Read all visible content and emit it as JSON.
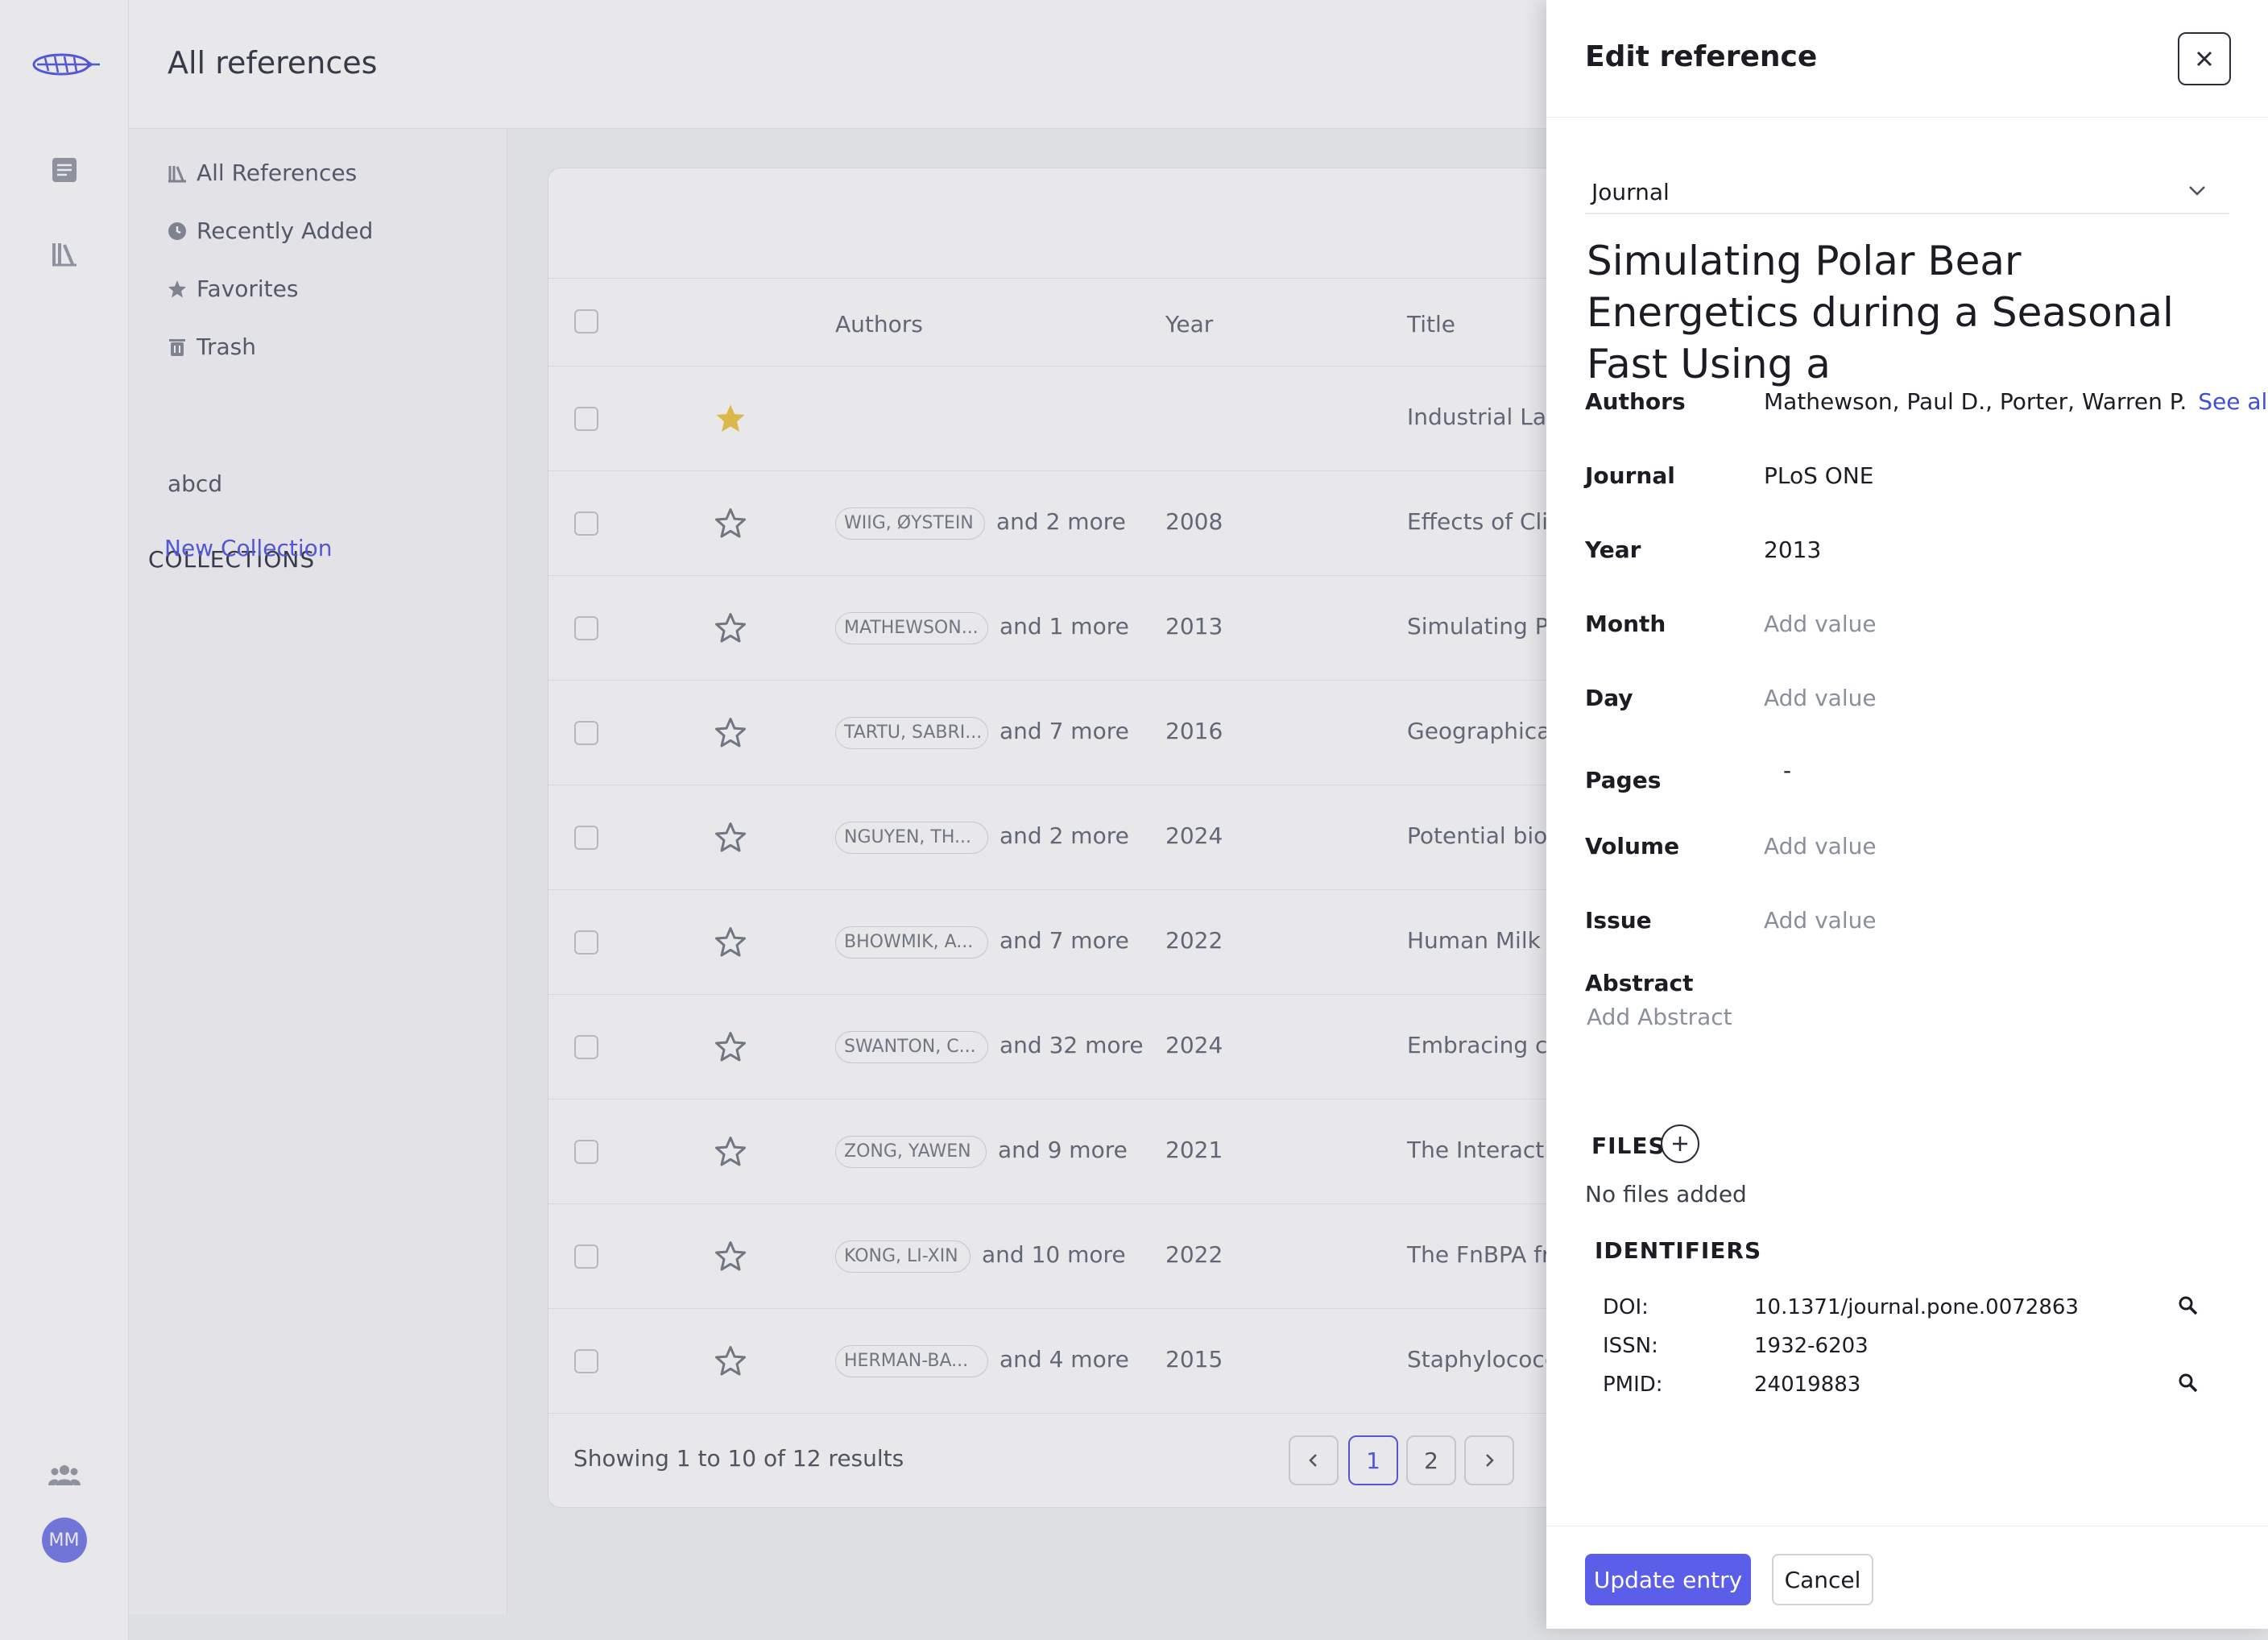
{
  "app": {
    "page_title": "All references",
    "avatar_initials": "MM",
    "colors": {
      "accent": "#5a5ee8",
      "favorite_star": "#f2c94c",
      "link": "#3f4fd6"
    }
  },
  "sidebar": {
    "nav": [
      {
        "label": "All References",
        "icon": "library-icon"
      },
      {
        "label": "Recently Added",
        "icon": "clock-icon"
      },
      {
        "label": "Favorites",
        "icon": "star-icon"
      },
      {
        "label": "Trash",
        "icon": "trash-icon"
      }
    ],
    "collections_title": "COLLECTIONS",
    "collections": [
      "abcd"
    ],
    "new_collection_label": "New Collection"
  },
  "table": {
    "columns": {
      "authors": "Authors",
      "year": "Year",
      "title": "Title"
    },
    "rows": [
      {
        "favorite": true,
        "author": "",
        "more": "",
        "year": "",
        "title": "Industrial Lase"
      },
      {
        "favorite": false,
        "author": "WIIG, ØYSTEIN",
        "more": "and 2 more",
        "year": "2008",
        "title": "Effects of Clir"
      },
      {
        "favorite": false,
        "author": "MATHEWSON...",
        "more": "and 1 more",
        "year": "2013",
        "title": "Simulating Po"
      },
      {
        "favorite": false,
        "author": "TARTU, SABRI...",
        "more": "and 7 more",
        "year": "2016",
        "title": "Geographical"
      },
      {
        "favorite": false,
        "author": "NGUYEN, TH...",
        "more": "and 2 more",
        "year": "2024",
        "title": "Potential biolo"
      },
      {
        "favorite": false,
        "author": "BHOWMIK, A...",
        "more": "and 7 more",
        "year": "2022",
        "title": "Human Milk O"
      },
      {
        "favorite": false,
        "author": "SWANTON, C...",
        "more": "and 32 more",
        "year": "2024",
        "title": "Embracing ca"
      },
      {
        "favorite": false,
        "author": "ZONG, YAWEN",
        "more": "and 9 more",
        "year": "2021",
        "title": "The Interactio"
      },
      {
        "favorite": false,
        "author": "KONG, LI-XIN",
        "more": "and 10 more",
        "year": "2022",
        "title": "The FnBPA fro"
      },
      {
        "favorite": false,
        "author": "HERMAN-BA...",
        "more": "and 4 more",
        "year": "2015",
        "title": "Staphylococc"
      }
    ],
    "showing_text": "Showing 1 to 10 of 12 results",
    "pages": [
      "1",
      "2"
    ],
    "current_page": "1"
  },
  "panel": {
    "title": "Edit reference",
    "type_value": "Journal",
    "ref_title": "Simulating Polar Bear Energetics during a Seasonal Fast Using a",
    "fields": {
      "authors_label": "Authors",
      "authors_value": "Mathewson, Paul D., Porter, Warren P.",
      "see_all": "See all",
      "journal_label": "Journal",
      "journal_value": "PLoS ONE",
      "year_label": "Year",
      "year_value": "2013",
      "month_label": "Month",
      "month_value": "Add value",
      "day_label": "Day",
      "day_value": "Add value",
      "pages_label": "Pages",
      "pages_value": "-",
      "volume_label": "Volume",
      "volume_value": "Add value",
      "issue_label": "Issue",
      "issue_value": "Add value",
      "abstract_label": "Abstract",
      "abstract_placeholder": "Add Abstract"
    },
    "files_title": "FILES",
    "no_files": "No files added",
    "identifiers_title": "IDENTIFIERS",
    "identifiers": [
      {
        "label": "DOI:",
        "value": "10.1371/journal.pone.0072863",
        "searchable": true
      },
      {
        "label": "ISSN:",
        "value": "1932-6203",
        "searchable": false
      },
      {
        "label": "PMID:",
        "value": "24019883",
        "searchable": true
      }
    ],
    "update_button": "Update entry",
    "cancel_button": "Cancel"
  }
}
